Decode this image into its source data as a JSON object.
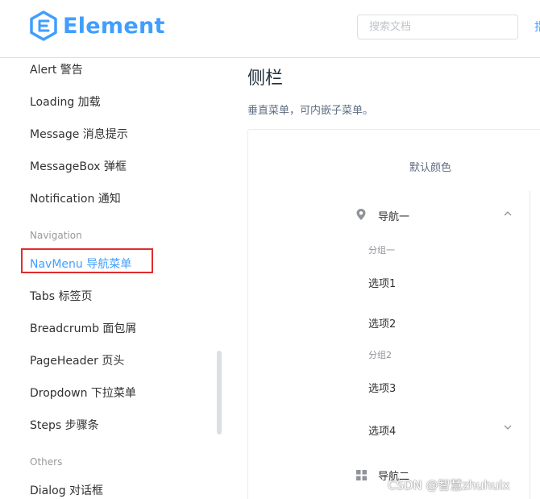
{
  "header": {
    "logo_text": "Element",
    "search_placeholder": "搜索文档",
    "nav_cut_text": "指"
  },
  "sidebar": {
    "items": [
      {
        "label": "Alert 警告"
      },
      {
        "label": "Loading 加载"
      },
      {
        "label": "Message 消息提示"
      },
      {
        "label": "MessageBox 弹框"
      },
      {
        "label": "Notification 通知"
      }
    ],
    "group_navigation": "Navigation",
    "nav_items": [
      {
        "label": "NavMenu 导航菜单",
        "active": true
      },
      {
        "label": "Tabs 标签页"
      },
      {
        "label": "Breadcrumb 面包屑"
      },
      {
        "label": "PageHeader 页头"
      },
      {
        "label": "Dropdown 下拉菜单"
      },
      {
        "label": "Steps 步骤条"
      }
    ],
    "group_others": "Others",
    "other_items": [
      {
        "label": "Dialog 对话框"
      }
    ]
  },
  "main": {
    "title": "侧栏",
    "description": "垂直菜单，可内嵌子菜单。",
    "demo": {
      "label": "默认颜色",
      "menu": {
        "submenu1": "导航一",
        "group1": "分组一",
        "option1": "选项1",
        "option2": "选项2",
        "group2": "分组2",
        "option3": "选项3",
        "option4": "选项4",
        "submenu2": "导航二"
      }
    }
  },
  "watermark": "CSDN @智慧zhuhuix",
  "colors": {
    "accent": "#409eff",
    "highlight_box": "#e02c2c",
    "text": "#303133",
    "muted": "#909399"
  },
  "icons": [
    "element-logo-icon",
    "location-icon",
    "chevron-up-icon",
    "chevron-down-icon",
    "menu-grid-icon"
  ]
}
